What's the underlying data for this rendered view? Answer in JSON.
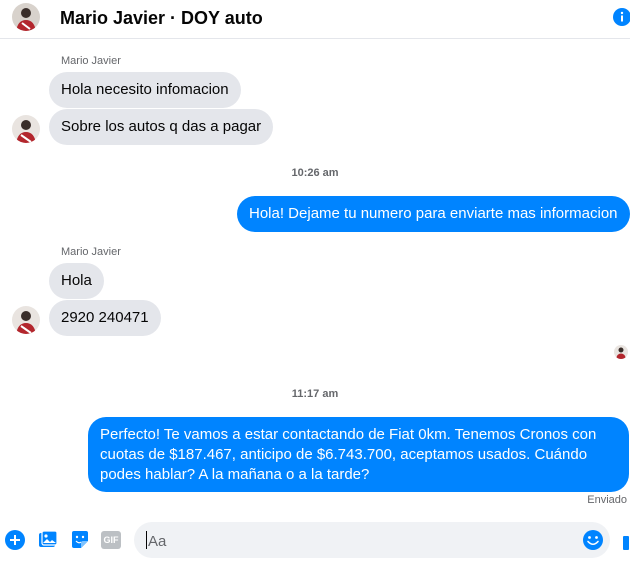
{
  "header": {
    "title": "Mario Javier · DOY auto",
    "avatar_icon": "user-avatar",
    "info_icon": "info-icon"
  },
  "colors": {
    "accent": "#0084ff",
    "incoming_bubble": "#e4e6eb",
    "secondary_text": "#65676b"
  },
  "groups": [
    {
      "sender": "Mario Javier",
      "messages": [
        "Hola necesito infomacion",
        "Sobre los autos q das a pagar"
      ]
    },
    {
      "timestamp": "10:26 am",
      "outgoing": "Hola! Dejame tu numero para enviarte mas informacion"
    },
    {
      "sender": "Mario Javier",
      "messages": [
        "Hola",
        "2920 240471"
      ]
    },
    {
      "timestamp": "11:17 am",
      "outgoing": "Perfecto! Te vamos a estar contactando de Fiat 0km. Tenemos Cronos con cuotas de $187.467, anticipo de $6.743.700, aceptamos usados. Cuándo podes hablar? A la mañana o a la tarde?",
      "status": "Enviado"
    }
  ],
  "composer": {
    "placeholder": "Aa",
    "tools": [
      "add-icon",
      "photo-icon",
      "sticker-icon",
      "gif-icon"
    ],
    "gif_label": "GIF",
    "emoji_icon": "emoji-icon"
  }
}
